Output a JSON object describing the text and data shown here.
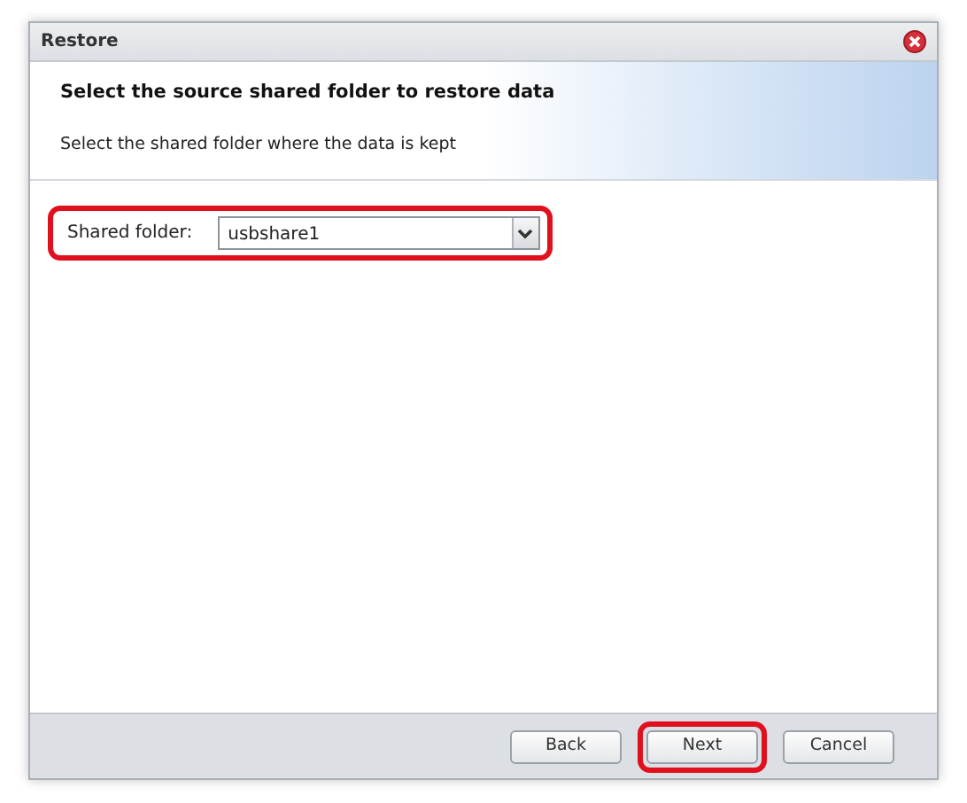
{
  "window": {
    "title": "Restore"
  },
  "header": {
    "title": "Select the source shared folder to restore data",
    "subtitle": "Select the shared folder where the data is kept"
  },
  "shared_folder": {
    "label": "Shared folder:",
    "value": "usbshare1",
    "highlighted": true
  },
  "buttons": [
    {
      "label": "Back",
      "highlighted": false
    },
    {
      "label": "Next",
      "highlighted": true
    },
    {
      "label": "Cancel",
      "highlighted": false
    }
  ]
}
